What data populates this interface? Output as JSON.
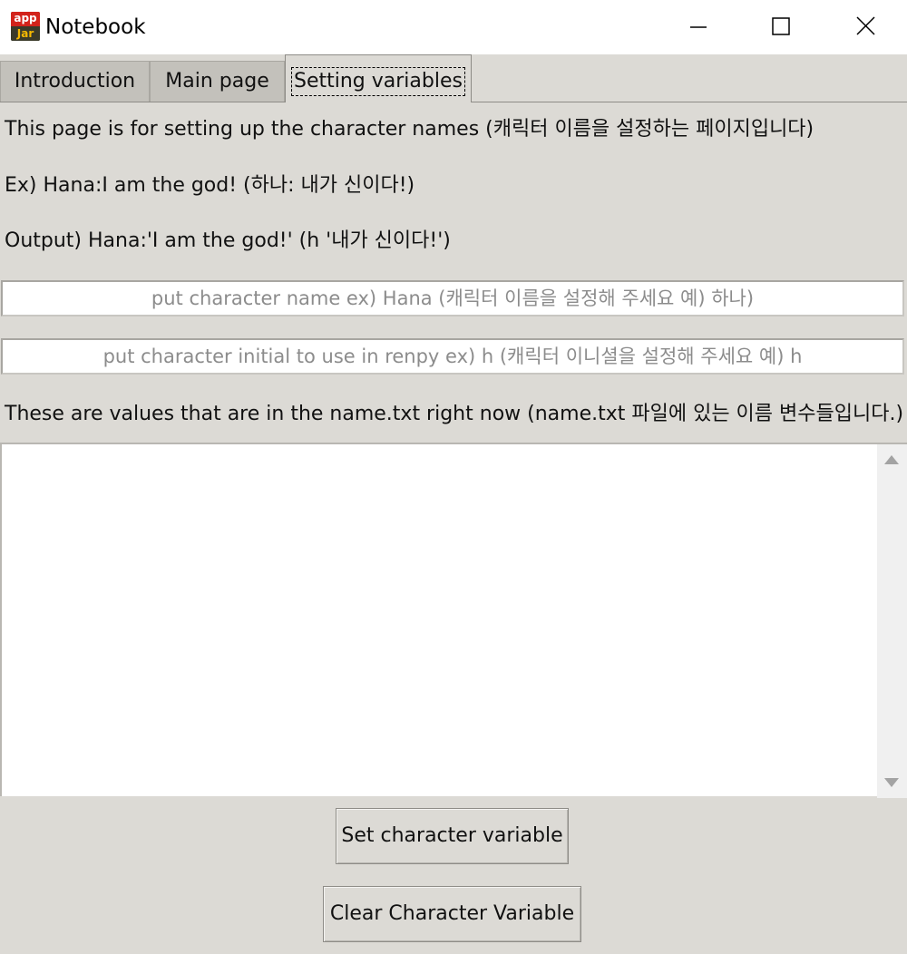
{
  "window": {
    "title": "Notebook",
    "app_icon": {
      "name": "appjar-icon",
      "top_text": "app",
      "bottom_text": "Jar"
    },
    "controls": {
      "minimize": "minimize-icon",
      "maximize": "maximize-icon",
      "close": "close-icon"
    }
  },
  "tabs": [
    {
      "label": "Introduction",
      "active": false
    },
    {
      "label": "Main page",
      "active": false
    },
    {
      "label": "Setting variables",
      "active": true
    }
  ],
  "content": {
    "line1": "This page is for setting up the character names (캐릭터 이름을 설정하는 페이지입니다)",
    "line2": "Ex) Hana:I am the god! (하나: 내가 신이다!)",
    "line3": "Output) Hana:'I am the god!' (h '내가 신이다!')",
    "name_input": {
      "value": "",
      "placeholder": "put character name ex) Hana (캐릭터 이름을 설정해 주세요 예) 하나)"
    },
    "initial_input": {
      "value": "",
      "placeholder": "put character initial to use in renpy ex) h (캐릭터 이니셜을 설정해 주세요 예) h"
    },
    "line4": "These are values that are in the name.txt right now (name.txt 파일에 있는 이름 변수들입니다.)",
    "values_text": ""
  },
  "buttons": {
    "set": "Set character variable",
    "clear": "Clear Character Variable"
  },
  "colors": {
    "window_bg": "#dcdad5",
    "titlebar_bg": "#ffffff",
    "inactive_tab": "#c3c1bb",
    "placeholder_text": "#8c8c8c"
  }
}
